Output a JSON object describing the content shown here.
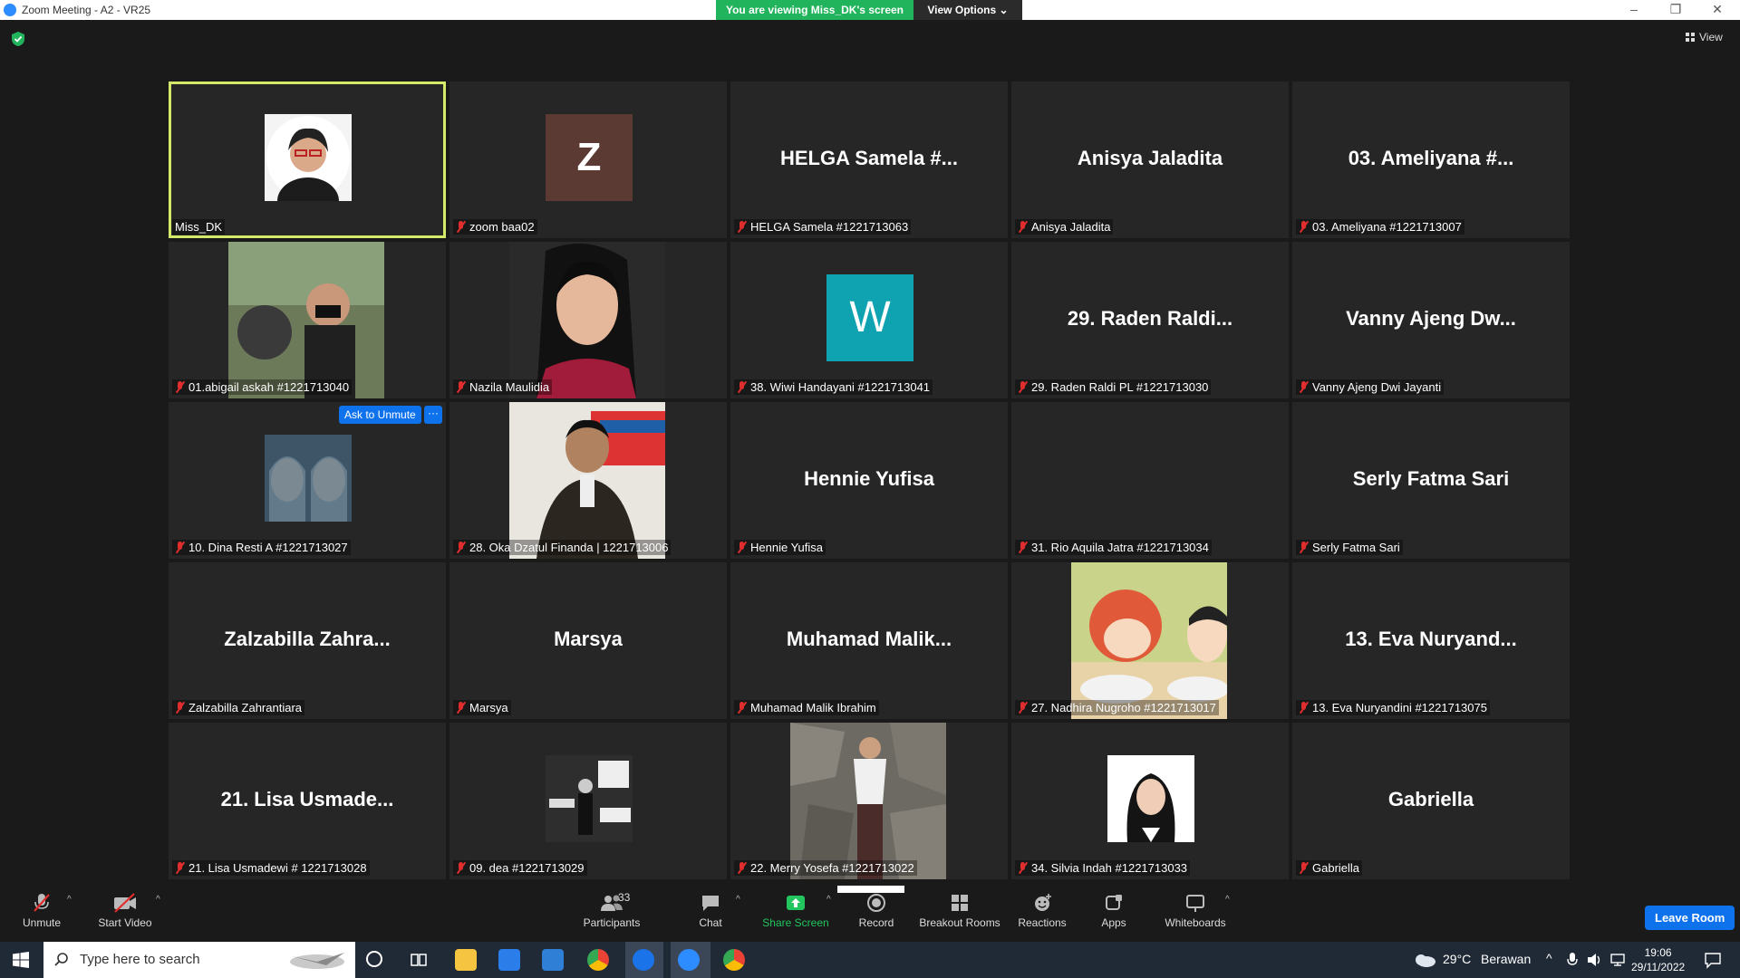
{
  "window": {
    "title": "Zoom Meeting - A2 - VR25",
    "viewing_banner": "You are viewing Miss_DK's screen",
    "view_options": "View Options",
    "view_button": "View"
  },
  "tiles": [
    {
      "label": "Miss_DK",
      "bigname": "",
      "muted": false,
      "kind": "avatar-photo",
      "active": true
    },
    {
      "label": "zoom baa02",
      "bigname": "",
      "muted": true,
      "kind": "letter",
      "letter": "Z",
      "color": "#5a3a32"
    },
    {
      "label": "HELGA Samela #1221713063",
      "bigname": "HELGA Samela #...",
      "muted": true,
      "kind": "name"
    },
    {
      "label": "Anisya Jaladita",
      "bigname": "Anisya Jaladita",
      "muted": true,
      "kind": "name"
    },
    {
      "label": "03. Ameliyana #1221713007",
      "bigname": "03. Ameliyana #...",
      "muted": true,
      "kind": "name"
    },
    {
      "label": "01.abigail askah #1221713040",
      "bigname": "",
      "muted": true,
      "kind": "video"
    },
    {
      "label": "Nazila Maulidia",
      "bigname": "",
      "muted": true,
      "kind": "video"
    },
    {
      "label": "38. Wiwi Handayani #1221713041",
      "bigname": "",
      "muted": true,
      "kind": "letter",
      "letter": "W",
      "color": "#0fa3b1"
    },
    {
      "label": "29. Raden Raldi PL #1221713030",
      "bigname": "29. Raden Raldi...",
      "muted": true,
      "kind": "name"
    },
    {
      "label": "Vanny Ajeng Dwi Jayanti",
      "bigname": "Vanny Ajeng Dw...",
      "muted": true,
      "kind": "name"
    },
    {
      "label": "10. Dina Resti A #1221713027",
      "bigname": "",
      "muted": true,
      "kind": "avatar-photo",
      "ask_unmute": "Ask to Unmute",
      "more": "···"
    },
    {
      "label": "28. Oka Dzatul Finanda | 1221713006",
      "bigname": "",
      "muted": true,
      "kind": "video"
    },
    {
      "label": "Hennie Yufisa",
      "bigname": "Hennie Yufisa",
      "muted": true,
      "kind": "name"
    },
    {
      "label": "31. Rio Aquila Jatra #1221713034",
      "bigname": "",
      "muted": true,
      "kind": "blank"
    },
    {
      "label": "Serly Fatma Sari",
      "bigname": "Serly Fatma Sari",
      "muted": true,
      "kind": "name"
    },
    {
      "label": "Zalzabilla Zahrantiara",
      "bigname": "Zalzabilla Zahra...",
      "muted": true,
      "kind": "name"
    },
    {
      "label": "Marsya",
      "bigname": "Marsya",
      "muted": true,
      "kind": "name"
    },
    {
      "label": "Muhamad Malik Ibrahim",
      "bigname": "Muhamad Malik...",
      "muted": true,
      "kind": "name"
    },
    {
      "label": "27. Nadhira Nugroho #1221713017",
      "bigname": "",
      "muted": true,
      "kind": "video"
    },
    {
      "label": "13. Eva Nuryandini #1221713075",
      "bigname": "13. Eva Nuryand...",
      "muted": true,
      "kind": "name"
    },
    {
      "label": "21. Lisa Usmadewi # 1221713028",
      "bigname": "21. Lisa Usmade...",
      "muted": true,
      "kind": "name"
    },
    {
      "label": "09. dea #1221713029",
      "bigname": "",
      "muted": true,
      "kind": "avatar-photo"
    },
    {
      "label": "22. Merry Yosefa #1221713022",
      "bigname": "",
      "muted": true,
      "kind": "video"
    },
    {
      "label": "34. Silvia Indah #1221713033",
      "bigname": "",
      "muted": true,
      "kind": "avatar-photo"
    },
    {
      "label": "Gabriella",
      "bigname": "Gabriella",
      "muted": true,
      "kind": "name"
    }
  ],
  "toolbar": {
    "unmute": "Unmute",
    "start_video": "Start Video",
    "participants": "Participants",
    "participants_count": "33",
    "chat": "Chat",
    "share_screen": "Share Screen",
    "record": "Record",
    "breakout_rooms": "Breakout Rooms",
    "reactions": "Reactions",
    "apps": "Apps",
    "whiteboards": "Whiteboards",
    "leave_room": "Leave Room"
  },
  "taskbar": {
    "search_placeholder": "Type here to search",
    "weather_temp": "29°C",
    "weather_text": "Berawan",
    "time": "19:06",
    "date": "29/11/2022"
  },
  "colors": {
    "accent_green": "#22b45c",
    "active_speaker": "#d6e86a",
    "zoom_blue": "#0e72ed",
    "muted_red": "#e02d2d"
  }
}
